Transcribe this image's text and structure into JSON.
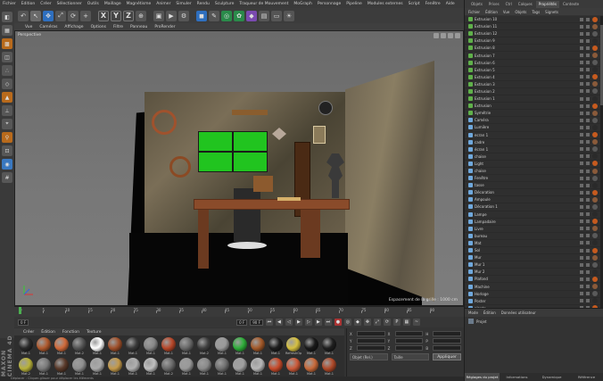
{
  "menubar": [
    "Fichier",
    "Edition",
    "Créer",
    "Sélectionner",
    "Outils",
    "Maillage",
    "Magnétisme",
    "Animer",
    "Simuler",
    "Rendu",
    "Sculpture",
    "Traqueur de Mouvement",
    "MoGraph",
    "Personnage",
    "Pipeline",
    "Modules externes",
    "Script",
    "Fenêtre",
    "Aide"
  ],
  "toolbar_icons": [
    "undo-icon",
    "cursor-icon",
    "move-icon",
    "scale-icon",
    "rotate-icon",
    "add-icon",
    "x-axis-icon",
    "y-axis-icon",
    "z-axis-icon",
    "world-icon",
    "render-region-icon",
    "render-view-icon",
    "render-settings-icon",
    "cube-icon",
    "pen-icon",
    "subdivision-icon",
    "array-icon",
    "deformer-icon",
    "scene-icon",
    "camera-icon",
    "light-icon"
  ],
  "axis_labels": [
    "X",
    "Y",
    "Z"
  ],
  "viewport": {
    "menu": [
      "Vue",
      "Caméras",
      "Affichage",
      "Options",
      "Filtre",
      "Panneau",
      "ProRender"
    ],
    "label": "Perspective",
    "grid_text": "Espacement de la grille : 1000 cm"
  },
  "timeline": {
    "ticks": [
      "0",
      "5",
      "10",
      "15",
      "20",
      "25",
      "30",
      "35",
      "40",
      "45",
      "50",
      "55",
      "60",
      "65",
      "70",
      "75",
      "80",
      "85",
      "90"
    ],
    "current_frame": "0 F",
    "start_field": "0 F",
    "end_field": "90 F",
    "end_field2": "90 F",
    "right_frame": "0 F"
  },
  "materials": {
    "menu": [
      "Créer",
      "Édition",
      "Fonction",
      "Texture"
    ],
    "items": [
      {
        "label": "Mat.1",
        "color": "#2a2a2a"
      },
      {
        "label": "Mat.1",
        "color": "#b05a2e"
      },
      {
        "label": "Mat.1",
        "color": "#d06a3a"
      },
      {
        "label": "Mat.2",
        "color": "#555555"
      },
      {
        "label": "Mat.1",
        "color": "#ffffff"
      },
      {
        "label": "Mat.1",
        "color": "#a0502a"
      },
      {
        "label": "Mat.1",
        "color": "#3a3a3a"
      },
      {
        "label": "Mat.1",
        "color": "#888888"
      },
      {
        "label": "Mat.1",
        "color": "#b8482a"
      },
      {
        "label": "Mat.1",
        "color": "#6a6a6a"
      },
      {
        "label": "Mat.2",
        "color": "#404040"
      },
      {
        "label": "Mat.1",
        "color": "#9a9a9a"
      },
      {
        "label": "Mat.1",
        "color": "#2fae3a"
      },
      {
        "label": "Mat.1",
        "color": "#a45a2a"
      },
      {
        "label": "Mat.1",
        "color": "#1e1e1e"
      },
      {
        "label": "RefreshOps",
        "color": "#d6c040"
      },
      {
        "label": "Mat.1",
        "color": "#1a1a1a"
      },
      {
        "label": "Mat.1",
        "color": "#202020"
      },
      {
        "label": "Mat.2",
        "color": "#b8b23a"
      },
      {
        "label": "Mat.1",
        "color": "#7a7a7a"
      },
      {
        "label": "Mat.1",
        "color": "#5a3a2a"
      },
      {
        "label": "Mat.1",
        "color": "#909090"
      },
      {
        "label": "Mat.1",
        "color": "#aaaaaa"
      },
      {
        "label": "Mat.1",
        "color": "#c49a4a"
      },
      {
        "label": "Mat.1",
        "color": "#b0b0b0"
      },
      {
        "label": "Mat.1",
        "color": "#c0c0c0"
      },
      {
        "label": "Mat.2",
        "color": "#6a6a6a"
      },
      {
        "label": "Mat.1",
        "color": "#999999"
      },
      {
        "label": "Mat.1",
        "color": "#8a8a8a"
      },
      {
        "label": "Mat.1",
        "color": "#707070"
      },
      {
        "label": "Mat.1",
        "color": "#a0a0a0"
      },
      {
        "label": "Mat.1",
        "color": "#b8b8b8"
      },
      {
        "label": "Mat.1",
        "color": "#c84a2a"
      },
      {
        "label": "Mat.1",
        "color": "#cc5a3a"
      },
      {
        "label": "Mat.1",
        "color": "#c86a3a"
      },
      {
        "label": "Mat.1",
        "color": "#b04a2a"
      }
    ]
  },
  "coords": {
    "rows": [
      [
        "X",
        "X",
        "H"
      ],
      [
        "Y",
        "Y",
        "P"
      ],
      [
        "Z",
        "Z",
        "B"
      ]
    ],
    "mode1": "Objet (Rel.)",
    "mode2": "Taille",
    "apply": "Appliquer"
  },
  "status": "Déplacer : Cliquer-glisser pour déplacer les éléments",
  "right_panel": {
    "tabs": [
      "Objets",
      "Prises",
      "Ctrl",
      "Calques",
      "Propriétés",
      "Contexte"
    ],
    "menu": [
      "Fichier",
      "Édition",
      "Vue",
      "Objets",
      "Tags",
      "Signets"
    ],
    "objects": [
      "Extrusion 10",
      "Extrusion 11",
      "Extrusion 12",
      "Extrusion 9",
      "Extrusion 8",
      "Extrusion 7",
      "Extrusion 6",
      "Extrusion 5",
      "Extrusion 4",
      "Extrusion 3",
      "Extrusion 2",
      "Extrusion 1",
      "Extrusion",
      "Symétrie",
      "Caméra",
      "Lumière",
      "ecran 1",
      "cadre",
      "écran 1",
      "chaise",
      "Light",
      "chaise",
      "Fenêtre",
      "tasse",
      "Décoration",
      "Ampoule",
      "Décoration 1",
      "Lampe",
      "Lampadaire",
      "Livre",
      "bureau",
      "Mat",
      "Sol",
      "Mur",
      "Mur 1",
      "Mur 2",
      "Plafond",
      "Machine",
      "Horloge",
      "Poster",
      "plante",
      "Armoire",
      "Armoire 1",
      "Objet 2",
      "tablette",
      "Objet 1",
      "Objet",
      "Extrusion"
    ],
    "attr_menu": [
      "Mode",
      "Édition",
      "Données utilisateur"
    ],
    "attr_item": "Projet",
    "bottom_tabs": [
      "Réglages du projet",
      "Informations",
      "Dynamique",
      "Référence"
    ]
  }
}
